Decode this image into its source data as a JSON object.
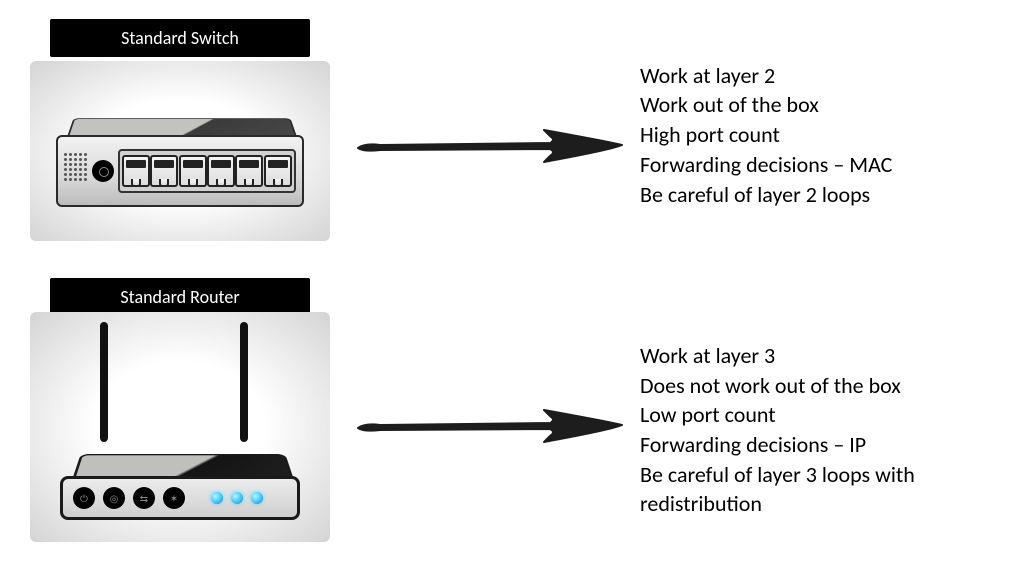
{
  "switch": {
    "label": "Standard Switch",
    "bullets": [
      "Work at layer 2",
      "Work out of the box",
      "High port count",
      "Forwarding decisions – MAC",
      "Be careful of layer 2 loops"
    ]
  },
  "router": {
    "label": "Standard Router",
    "bullets": [
      "Work at layer 3",
      "Does not work out of the box",
      "Low port count",
      "Forwarding decisions – IP",
      "Be careful of layer 3 loops with redistribution"
    ]
  }
}
